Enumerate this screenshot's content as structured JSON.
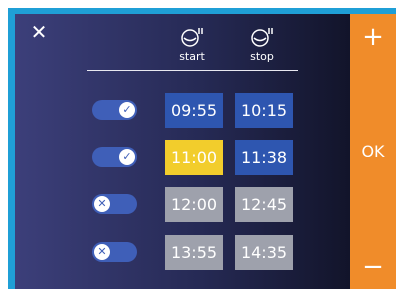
{
  "header": {
    "close_icon": "close-icon",
    "start_label": "start",
    "stop_label": "stop",
    "start_icon": "timer-start-icon",
    "stop_icon": "timer-stop-icon"
  },
  "rows": [
    {
      "enabled": true,
      "start": "09:55",
      "stop": "10:15",
      "start_style": "blue",
      "stop_style": "blue"
    },
    {
      "enabled": true,
      "start": "11:00",
      "stop": "11:38",
      "start_style": "yellow",
      "stop_style": "blue"
    },
    {
      "enabled": false,
      "start": "12:00",
      "stop": "12:45",
      "start_style": "grey",
      "stop_style": "grey"
    },
    {
      "enabled": false,
      "start": "13:55",
      "stop": "14:35",
      "start_style": "grey",
      "stop_style": "grey"
    }
  ],
  "sidebar": {
    "plus_label": "+",
    "ok_label": "OK",
    "minus_label": "−"
  },
  "colors": {
    "accent_orange": "#f08c2a",
    "time_blue": "#2e56b0",
    "time_selected": "#f2cd2c",
    "time_disabled": "#9ea1ac",
    "frame_blue": "#1f9fd6"
  }
}
